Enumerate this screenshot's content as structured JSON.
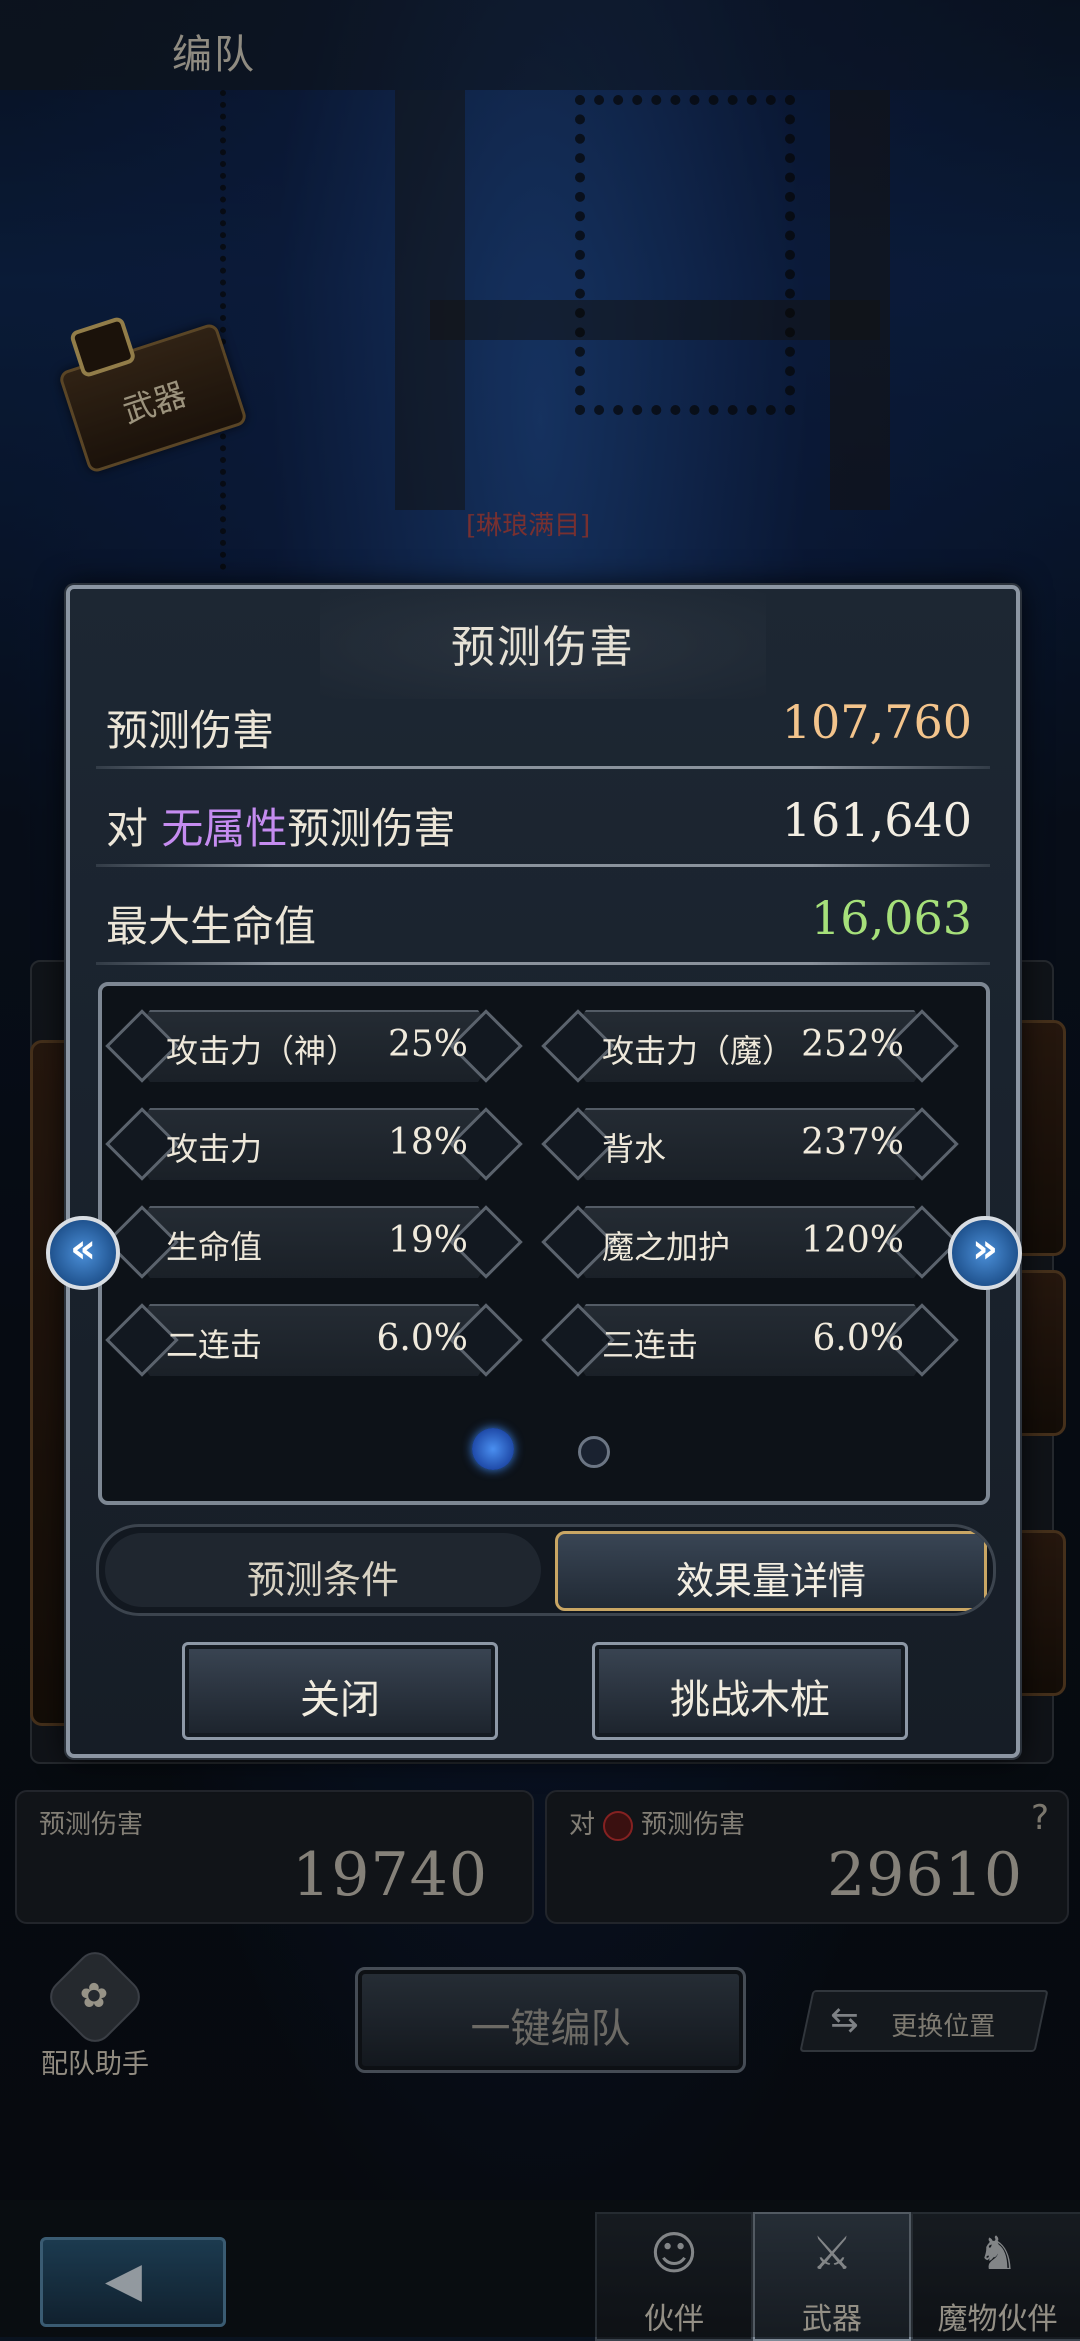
{
  "header": {
    "title": "编队"
  },
  "background": {
    "weapon_tag": "武器",
    "gold_name": "[琳琅满目]"
  },
  "modal": {
    "title": "预测伤害",
    "rows": [
      {
        "label": "预测伤害",
        "value": "107,760",
        "color": "#f3c48c"
      },
      {
        "label_prefix": "对",
        "label_element": "无属性",
        "label_suffix": "预测伤害",
        "value": "161,640",
        "color": "#f2ede2"
      },
      {
        "label": "最大生命值",
        "value": "16,063",
        "color": "#a6e07a"
      }
    ],
    "stats": [
      {
        "name": "攻击力（神）",
        "value": "25%"
      },
      {
        "name": "攻击力（魔）",
        "value": "252%"
      },
      {
        "name": "攻击力",
        "value": "18%"
      },
      {
        "name": "背水",
        "value": "237%"
      },
      {
        "name": "生命值",
        "value": "19%"
      },
      {
        "name": "魔之加护",
        "value": "120%"
      },
      {
        "name": "二连击",
        "value": "6.0%"
      },
      {
        "name": "三连击",
        "value": "6.0%"
      }
    ],
    "pager": {
      "current": 1,
      "total": 2
    },
    "prev_icon": "double-chevron-left-icon",
    "next_icon": "double-chevron-right-icon",
    "tabs": {
      "left": "预测条件",
      "right": "效果量详情",
      "active": "right"
    },
    "buttons": {
      "close": "关闭",
      "challenge": "挑战木桩"
    }
  },
  "page": {
    "pred_damage": {
      "label": "预测伤害",
      "value": "19740"
    },
    "pred_element": {
      "prefix": "对",
      "label": "预测伤害",
      "value": "29610",
      "help": "?"
    },
    "assist_label": "配队助手",
    "auto_team": "一键编队",
    "swap": "更换位置"
  },
  "bottom_nav": [
    {
      "label": "伙伴",
      "icon": "person-icon",
      "active": false
    },
    {
      "label": "武器",
      "icon": "crossed-swords-icon",
      "active": true
    },
    {
      "label": "魔物伙伴",
      "icon": "dragon-icon",
      "active": false
    }
  ]
}
